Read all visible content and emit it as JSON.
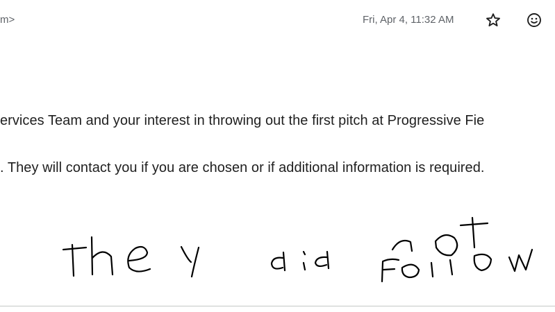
{
  "header": {
    "sender_fragment": "m>",
    "timestamp": "Fri, Apr 4, 11:32 AM",
    "star_icon": "star-outline-icon",
    "emoji_icon": "add-reaction-icon"
  },
  "message": {
    "lines": [
      "ervices Team and your interest in throwing out the first pitch at Progressive Fie",
      ". They will contact you if you are chosen or if additional information is required."
    ],
    "handwritten_note": "they did not follow"
  },
  "colors": {
    "text": "#1f1f1f",
    "meta": "#5f6368",
    "divider": "#c4c7c5",
    "ink": "#000000"
  }
}
